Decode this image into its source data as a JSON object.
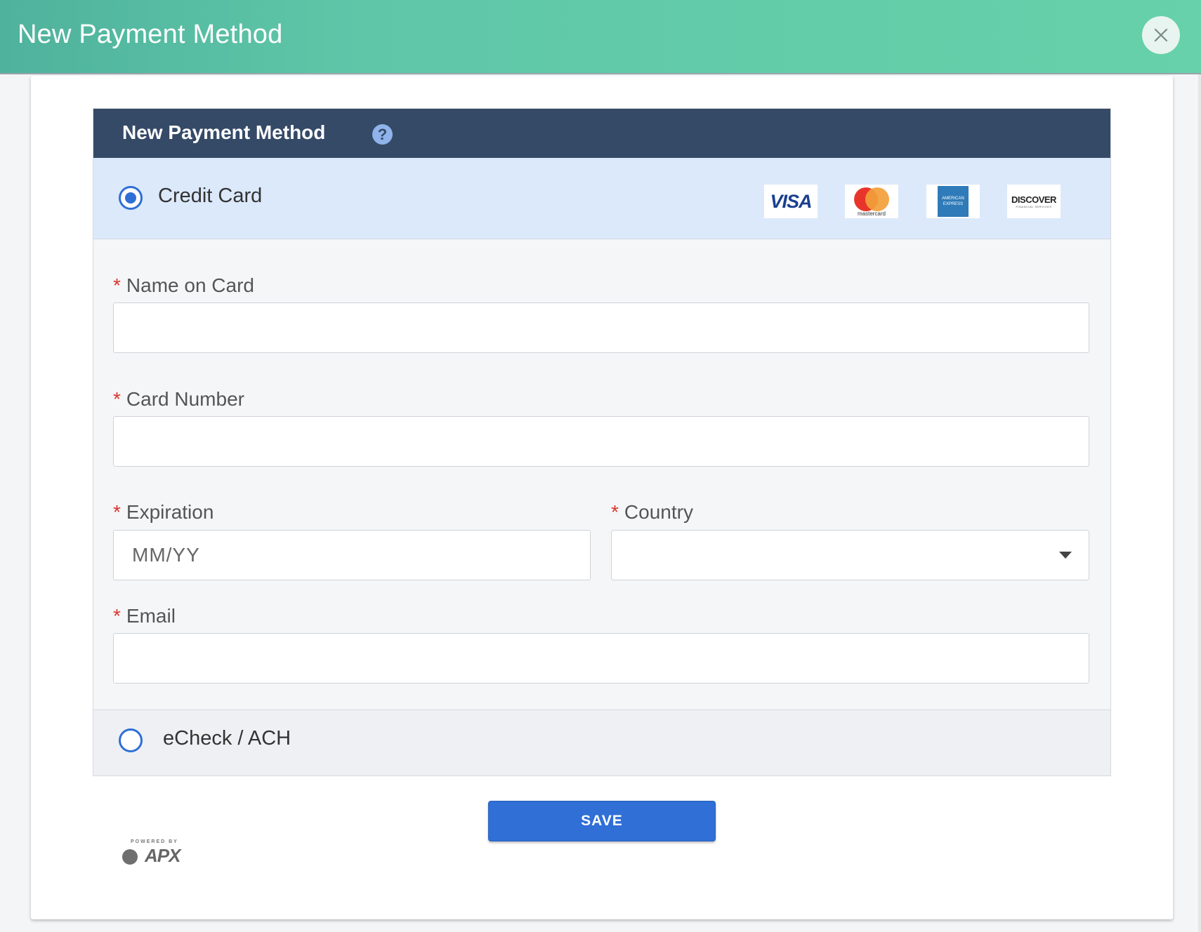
{
  "window": {
    "title": "New Payment Method",
    "close_icon": "close-icon"
  },
  "panel": {
    "title": "New Payment Method",
    "help_glyph": "?"
  },
  "payment_options": {
    "credit_card": {
      "label": "Credit Card",
      "selected": true
    },
    "echeck": {
      "label": "eCheck / ACH",
      "selected": false
    }
  },
  "card_brands": {
    "visa": "VISA",
    "mastercard": "mastercard",
    "amex_line1": "AMERICAN",
    "amex_line2": "EXPRESS",
    "discover": "DISCOVER",
    "discover_sub": "FINANCIAL SERVICES"
  },
  "fields": {
    "required_mark": "*",
    "name_on_card": {
      "label": "Name on Card",
      "value": ""
    },
    "card_number": {
      "label": "Card Number",
      "value": ""
    },
    "expiration": {
      "label": "Expiration",
      "placeholder": "MM/YY",
      "value": ""
    },
    "country": {
      "label": "Country",
      "value": ""
    },
    "email": {
      "label": "Email",
      "value": ""
    }
  },
  "actions": {
    "save_label": "SAVE"
  },
  "footer": {
    "powered_by": "POWERED BY",
    "brand": "APX"
  },
  "colors": {
    "accent": "#2f6fd6",
    "header_bg": "#354a67",
    "topbar": "#5fc7a8",
    "required": "#d9342b"
  }
}
